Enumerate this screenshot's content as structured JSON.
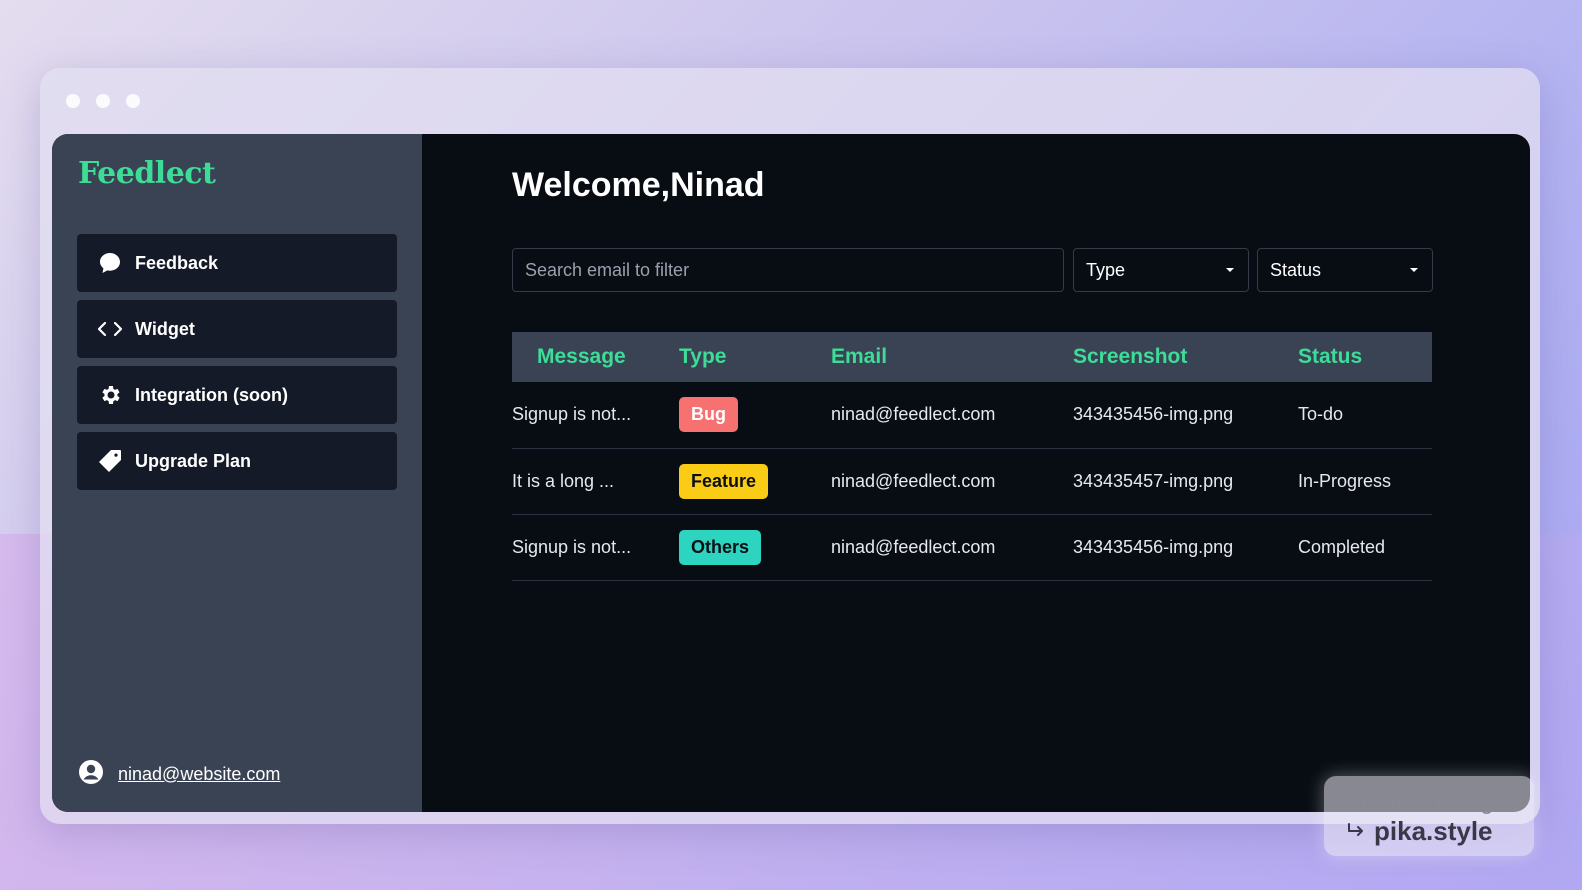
{
  "brand": "Feedlect",
  "nav": [
    {
      "label": "Feedback",
      "icon": "chat-bubble-icon"
    },
    {
      "label": "Widget",
      "icon": "code-brackets-icon"
    },
    {
      "label": "Integration (soon)",
      "icon": "gear-icon"
    },
    {
      "label": "Upgrade Plan",
      "icon": "tag-icon"
    }
  ],
  "user": {
    "email": "ninad@website.com",
    "icon": "user-circle-icon"
  },
  "main": {
    "welcome": "Welcome,Ninad",
    "search_placeholder": "Search email to filter",
    "filters": {
      "type": "Type",
      "status": "Status"
    }
  },
  "table": {
    "headers": [
      "Message",
      "Type",
      "Email",
      "Screenshot",
      "Status"
    ],
    "rows": [
      {
        "message": "Signup is not...",
        "type": "Bug",
        "email": "ninad@feedlect.com",
        "screenshot": "343435456-img.png",
        "status": "To-do"
      },
      {
        "message": "It is a long ...",
        "type": "Feature",
        "email": "ninad@feedlect.com",
        "screenshot": "343435457-img.png",
        "status": "In-Progress"
      },
      {
        "message": "Signup is not...",
        "type": "Others",
        "email": "ninad@feedlect.com",
        "screenshot": "343435456-img.png",
        "status": "Completed"
      }
    ]
  },
  "type_colors": {
    "Bug": "#f87171",
    "Feature": "#facc15",
    "Others": "#2dd4bf"
  },
  "colors": {
    "accent": "#3ddc97",
    "sidebar": "#394354",
    "background": "#080d14"
  },
  "watermark": {
    "line1": "Created using",
    "line2": "pika.style"
  }
}
